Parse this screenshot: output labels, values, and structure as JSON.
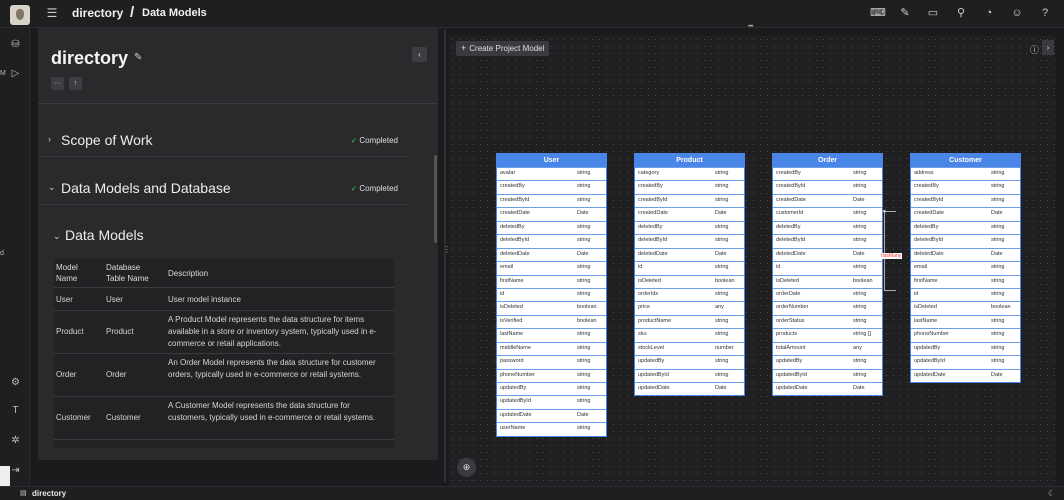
{
  "header": {
    "breadcrumb_root": "directory",
    "breadcrumb_separator": "/",
    "breadcrumb_page": "Data Models",
    "icons": [
      "code-icon",
      "magic-wand-icon",
      "layout-icon",
      "search-icon",
      "bell-icon",
      "user-icon",
      "help-icon"
    ]
  },
  "left_rail": {
    "letter_m": "M",
    "letter_d": "d"
  },
  "document": {
    "title": "directory",
    "more_label": "···",
    "up_label": "↑",
    "sections": [
      {
        "title": "Scope of Work",
        "status": "Completed"
      },
      {
        "title": "Data Models and Database",
        "status": "Completed"
      }
    ],
    "subsection_title": "Data Models",
    "table": {
      "headers": [
        "Model Name",
        "Database Table Name",
        "Description"
      ],
      "rows": [
        {
          "model": "User",
          "table": "User",
          "description": "User model instance"
        },
        {
          "model": "Product",
          "table": "Product",
          "description": "A Product Model represents the data structure for items available in a store or inventory system, typically used in e-commerce or retail applications."
        },
        {
          "model": "Order",
          "table": "Order",
          "description": "An Order Model represents the data structure for customer orders, typically used in e-commerce or retail systems."
        },
        {
          "model": "Customer",
          "table": "Customer",
          "description": "A Customer Model represents the data structure for customers, typically used in e-commerce or retail systems."
        }
      ]
    }
  },
  "canvas": {
    "create_button_label": "Create Project Model",
    "relation_label": "hasMany",
    "models": [
      {
        "name": "User",
        "fields": [
          [
            "avatar",
            "string"
          ],
          [
            "createdBy",
            "string"
          ],
          [
            "createdById",
            "string"
          ],
          [
            "createdDate",
            "Date"
          ],
          [
            "deletedBy",
            "string"
          ],
          [
            "deletedById",
            "string"
          ],
          [
            "deletedDate",
            "Date"
          ],
          [
            "email",
            "string"
          ],
          [
            "firstName",
            "string"
          ],
          [
            "id",
            "string"
          ],
          [
            "isDeleted",
            "boolean"
          ],
          [
            "isVerified",
            "boolean"
          ],
          [
            "lastName",
            "string"
          ],
          [
            "middleName",
            "string"
          ],
          [
            "password",
            "string"
          ],
          [
            "phoneNumber",
            "string"
          ],
          [
            "updatedBy",
            "string"
          ],
          [
            "updatedById",
            "string"
          ],
          [
            "updatedDate",
            "Date"
          ],
          [
            "userName",
            "string"
          ]
        ]
      },
      {
        "name": "Product",
        "fields": [
          [
            "category",
            "string"
          ],
          [
            "createdBy",
            "string"
          ],
          [
            "createdById",
            "string"
          ],
          [
            "createdDate",
            "Date"
          ],
          [
            "deletedBy",
            "string"
          ],
          [
            "deletedById",
            "string"
          ],
          [
            "deletedDate",
            "Date"
          ],
          [
            "id",
            "string"
          ],
          [
            "isDeleted",
            "boolean"
          ],
          [
            "orderIds",
            "string"
          ],
          [
            "price",
            "any"
          ],
          [
            "productName",
            "string"
          ],
          [
            "sku",
            "string"
          ],
          [
            "stockLevel",
            "number"
          ],
          [
            "updatedBy",
            "string"
          ],
          [
            "updatedById",
            "string"
          ],
          [
            "updatedDate",
            "Date"
          ]
        ]
      },
      {
        "name": "Order",
        "fields": [
          [
            "createdBy",
            "string"
          ],
          [
            "createdById",
            "string"
          ],
          [
            "createdDate",
            "Date"
          ],
          [
            "customerId",
            "string"
          ],
          [
            "deletedBy",
            "string"
          ],
          [
            "deletedById",
            "string"
          ],
          [
            "deletedDate",
            "Date"
          ],
          [
            "id",
            "string"
          ],
          [
            "isDeleted",
            "boolean"
          ],
          [
            "orderDate",
            "string"
          ],
          [
            "orderNumber",
            "string"
          ],
          [
            "orderStatus",
            "string"
          ],
          [
            "products",
            "string []"
          ],
          [
            "totalAmount",
            "any"
          ],
          [
            "updatedBy",
            "string"
          ],
          [
            "updatedById",
            "string"
          ],
          [
            "updatedDate",
            "Date"
          ]
        ]
      },
      {
        "name": "Customer",
        "fields": [
          [
            "address",
            "string"
          ],
          [
            "createdBy",
            "string"
          ],
          [
            "createdById",
            "string"
          ],
          [
            "createdDate",
            "Date"
          ],
          [
            "deletedBy",
            "string"
          ],
          [
            "deletedById",
            "string"
          ],
          [
            "deletedDate",
            "Date"
          ],
          [
            "email",
            "string"
          ],
          [
            "firstName",
            "string"
          ],
          [
            "id",
            "string"
          ],
          [
            "isDeleted",
            "boolean"
          ],
          [
            "lastName",
            "string"
          ],
          [
            "phoneNumber",
            "string"
          ],
          [
            "updatedBy",
            "string"
          ],
          [
            "updatedById",
            "string"
          ],
          [
            "updatedDate",
            "Date"
          ]
        ]
      }
    ]
  },
  "statusbar": {
    "label": "directory"
  },
  "colors": {
    "accent": "#4a86e8",
    "success": "#3fbf5a",
    "relation": "#e63a3a"
  }
}
